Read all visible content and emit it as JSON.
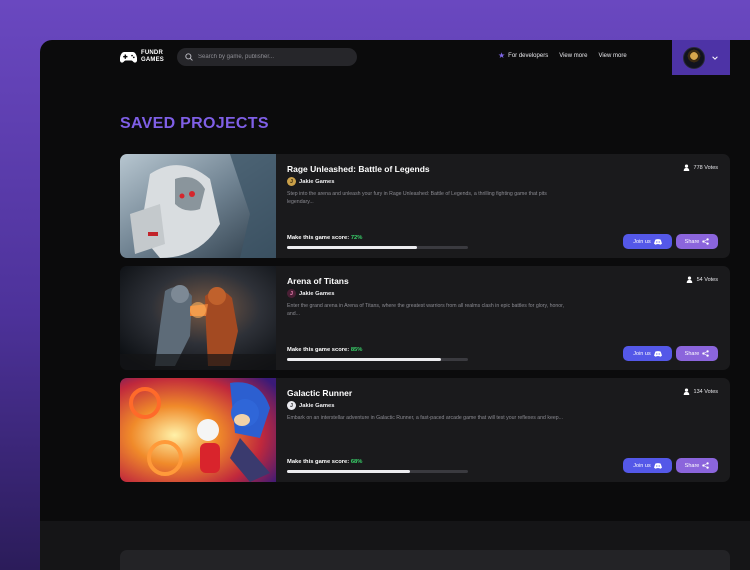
{
  "header": {
    "logo_text": "FUNDR\nGAMES",
    "search_placeholder": "Search by game, publisher...",
    "nav": [
      {
        "label": "For developers",
        "icon": "star-icon"
      },
      {
        "label": "View more"
      },
      {
        "label": "View more"
      }
    ]
  },
  "page": {
    "title": "SAVED PROJECTS"
  },
  "colors": {
    "accent": "#7f5fe6",
    "join_button": "#5458e8",
    "share_button": "#8b65dc",
    "score_green": "#39d36a"
  },
  "projects": [
    {
      "title": "Rage Unleashed: Battle of Legends",
      "publisher": "Jakie Games",
      "description": "Step into the arena and unleash your fury in Rage Unleashed: Battle of Legends, a thrilling fighting game that pits legendary...",
      "score_label": "Make this game score:",
      "score": "72%",
      "score_value": 0.72,
      "votes": "778 Votes",
      "join_label": "Join us",
      "share_label": "Share"
    },
    {
      "title": "Arena of Titans",
      "publisher": "Jakie Games",
      "description": "Enter the grand arena in Arena of Titans, where the greatest warriors from all realms clash in epic battles for glory, honor, and...",
      "score_label": "Make this game score:",
      "score": "85%",
      "score_value": 0.85,
      "votes": "54 Votes",
      "join_label": "Join us",
      "share_label": "Share"
    },
    {
      "title": "Galactic Runner",
      "publisher": "Jakie Games",
      "description": "Embark on an interstellar adventure in Galactic Runner, a fast-paced arcade game that will test your reflexes and keep...",
      "score_label": "Make this game score:",
      "score": "68%",
      "score_value": 0.68,
      "votes": "134 Votes",
      "join_label": "Join us",
      "share_label": "Share"
    }
  ]
}
